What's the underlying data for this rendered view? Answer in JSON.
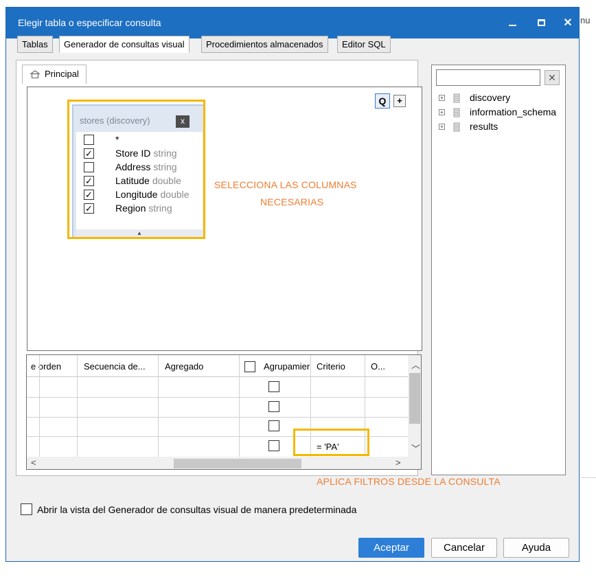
{
  "window": {
    "title": "Elegir tabla o especificar consulta"
  },
  "tabs": [
    {
      "label": "Tablas"
    },
    {
      "label": "Generador de consultas visual"
    },
    {
      "label": "Procedimientos almacenados"
    },
    {
      "label": "Editor SQL"
    }
  ],
  "subtab": {
    "label": "Principal"
  },
  "canvas": {
    "zoom_label": "Q",
    "add_label": "+"
  },
  "table_box": {
    "name": "stores (discovery)",
    "close_label": "x",
    "columns": [
      {
        "name": "*",
        "type": "",
        "checked": false
      },
      {
        "name": "Store ID",
        "type": "string",
        "checked": true
      },
      {
        "name": "Address",
        "type": "string",
        "checked": false
      },
      {
        "name": "Latitude",
        "type": "double",
        "checked": true
      },
      {
        "name": "Longitude",
        "type": "double",
        "checked": true
      },
      {
        "name": "Region",
        "type": "string",
        "checked": true
      }
    ]
  },
  "annotations": {
    "select_columns": [
      "SELECCIONA LAS COLUMNAS",
      "NECESARIAS"
    ],
    "apply_filters": "APLICA FILTROS DESDE LA CONSULTA"
  },
  "grid": {
    "headers": [
      "e orden",
      "Secuencia de...",
      "Agregado",
      "Agrupamier",
      "Criterio",
      "O..."
    ],
    "rows": [
      {
        "criterio": ""
      },
      {
        "criterio": ""
      },
      {
        "criterio": ""
      },
      {
        "criterio": "= 'PA'"
      }
    ]
  },
  "tree": {
    "items": [
      {
        "label": "discovery"
      },
      {
        "label": "information_schema"
      },
      {
        "label": "results"
      }
    ]
  },
  "default_view": {
    "label": "Abrir la vista del Generador de consultas visual de manera predeterminada",
    "checked": false
  },
  "buttons": {
    "ok": "Aceptar",
    "cancel": "Cancelar",
    "help": "Ayuda"
  },
  "background": {
    "stray_text": "nu"
  },
  "colors": {
    "titlebar": "#1d6fc1",
    "annotation": "#ee7d31",
    "highlight": "#f5b800",
    "primary_button": "#2c7ed6"
  }
}
